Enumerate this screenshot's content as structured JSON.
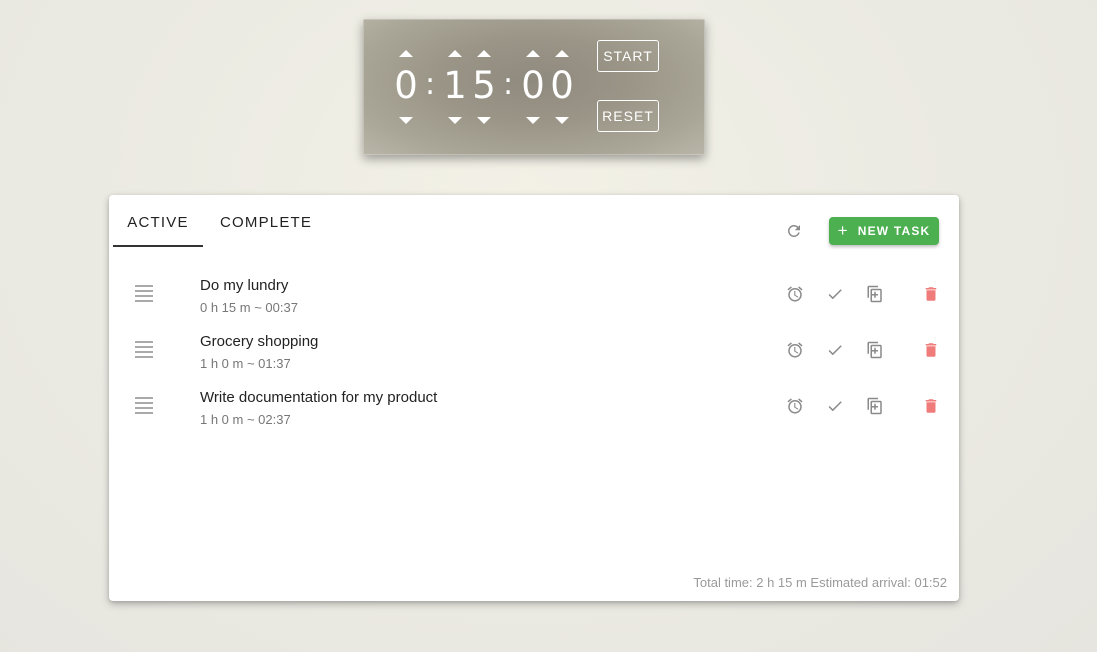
{
  "timer": {
    "hours": "0",
    "minutes_tens": "1",
    "minutes_ones": "5",
    "seconds_tens": "0",
    "seconds_ones": "0",
    "separator": ":",
    "start_label": "START",
    "reset_label": "RESET"
  },
  "tabs": [
    {
      "label": "ACTIVE",
      "selected": true
    },
    {
      "label": "COMPLETE",
      "selected": false
    }
  ],
  "toolbar": {
    "refresh_icon": "refresh-icon",
    "new_task_label": "NEW TASK",
    "new_task_plus": "+"
  },
  "tasks": [
    {
      "title": "Do my lundry",
      "meta": "0 h 15 m ~ 00:37"
    },
    {
      "title": "Grocery shopping",
      "meta": "1 h 0 m ~ 01:37"
    },
    {
      "title": "Write documentation for my product",
      "meta": "1 h 0 m ~ 02:37"
    }
  ],
  "footer": {
    "totals": "Total time: 2 h 15 m Estimated arrival: 01:52"
  },
  "colors": {
    "accent_green": "#4caf50",
    "delete_red": "#f07b7b",
    "icon_gray": "#8a8a8a"
  }
}
